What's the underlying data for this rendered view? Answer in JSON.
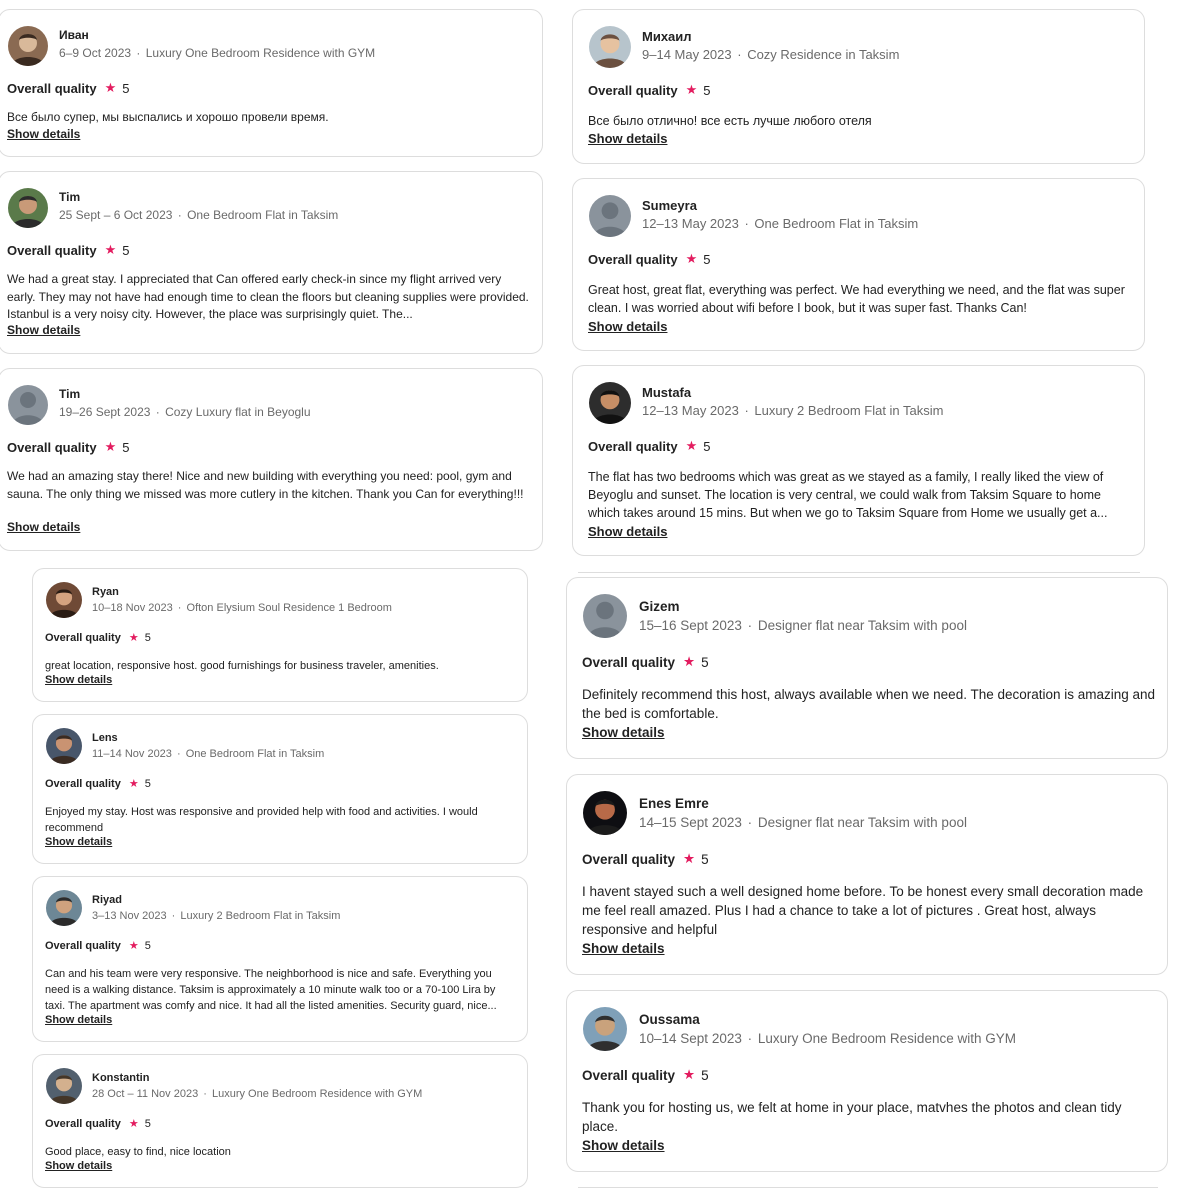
{
  "colors": {
    "star": "#e31c5f",
    "border": "#dddddd",
    "muted": "#6a6a6a",
    "text": "#222222"
  },
  "rating_label": "Overall quality",
  "star_glyph": "★",
  "show_details_label": "Show details",
  "reviews": [
    {
      "name": "Иван",
      "dates": "6–9 Oct 2023",
      "listing": "Luxury One Bedroom Residence with GYM",
      "rating": "5",
      "text": "Все было супер, мы выспались и хорошо провели время.",
      "avatar": "user-photo-icon"
    },
    {
      "name": "Tim",
      "dates": "25 Sept – 6 Oct 2023",
      "listing": "One Bedroom Flat in Taksim",
      "rating": "5",
      "text": "We had a great stay. I appreciated that Can offered early check-in since my flight arrived very early. They may not have had enough time to clean the floors but cleaning supplies were provided. Istanbul is a very noisy city. However, the place was surprisingly quiet. The...",
      "avatar": "user-photo-icon"
    },
    {
      "name": "Tim",
      "dates": "19–26 Sept 2023",
      "listing": "Cozy Luxury flat in Beyoglu",
      "rating": "5",
      "text": "We had an amazing stay there! Nice and new building with everything you need: pool, gym and sauna. The only thing we missed was more cutlery in the kitchen. Thank you Can for everything!!!",
      "avatar": "default-user-icon"
    },
    {
      "name": "Михаил",
      "dates": "9–14 May 2023",
      "listing": "Cozy Residence in Taksim",
      "rating": "5",
      "text": "Все было отлично! все есть лучше любого отеля",
      "avatar": "user-photo-icon"
    },
    {
      "name": "Sumeyra",
      "dates": "12–13 May 2023",
      "listing": "One Bedroom Flat in Taksim",
      "rating": "5",
      "text": "Great host, great flat, everything was perfect. We had everything we need, and the flat was super clean. I was worried about wifi before I book, but it was super fast. Thanks Can!",
      "avatar": "default-user-icon"
    },
    {
      "name": "Mustafa",
      "dates": "12–13 May 2023",
      "listing": "Luxury 2 Bedroom Flat in Taksim",
      "rating": "5",
      "text": "The flat has two bedrooms which was great as we stayed as a family, I really liked the view of Beyoglu and sunset. The location is very central, we could walk from Taksim Square to home which takes around 15 mins. But when we go to Taksim Square from Home we usually get a...",
      "avatar": "user-photo-icon"
    },
    {
      "name": "Ryan",
      "dates": "10–18 Nov 2023",
      "listing": "Ofton Elysium Soul Residence 1 Bedroom",
      "rating": "5",
      "text": "great location, responsive host. good furnishings for business traveler, amenities.",
      "avatar": "user-photo-icon"
    },
    {
      "name": "Lens",
      "dates": "11–14 Nov 2023",
      "listing": "One Bedroom Flat in Taksim",
      "rating": "5",
      "text": "Enjoyed my stay. Host was responsive and provided help with food and activities. I would recommend",
      "avatar": "user-photo-icon"
    },
    {
      "name": "Riyad",
      "dates": "3–13 Nov 2023",
      "listing": "Luxury 2 Bedroom Flat in Taksim",
      "rating": "5",
      "text": "Can and his team were very responsive. The neighborhood is nice and safe. Everything you need is a walking distance. Taksim is approximately a 10 minute walk too or a 70-100 Lira by taxi. The apartment was comfy and nice. It had all the listed amenities. Security guard, nice...",
      "avatar": "user-photo-icon"
    },
    {
      "name": "Konstantin",
      "dates": "28 Oct – 11 Nov 2023",
      "listing": "Luxury One Bedroom Residence with GYM",
      "rating": "5",
      "text": "Good place, easy to find, nice location",
      "avatar": "user-photo-icon"
    },
    {
      "name": "Gizem",
      "dates": "15–16 Sept 2023",
      "listing": "Designer flat near Taksim with pool",
      "rating": "5",
      "text": "Definitely recommend this host, always available when we need. The decoration is amazing and the bed is comfortable.",
      "avatar": "default-user-icon"
    },
    {
      "name": "Enes Emre",
      "dates": "14–15 Sept 2023",
      "listing": "Designer flat near Taksim with pool",
      "rating": "5",
      "text": "I havent stayed such a well designed home before. To be honest every small decoration made me feel reall amazed. Plus I had a chance to take a lot of pictures . Great host, always responsive and helpful",
      "avatar": "user-photo-icon"
    },
    {
      "name": "Oussama",
      "dates": "10–14 Sept 2023",
      "listing": "Luxury One Bedroom Residence with GYM",
      "rating": "5",
      "text": "Thank you for hosting us, we felt at home in your place, matvhes the photos and clean tidy place.",
      "avatar": "user-photo-icon"
    }
  ]
}
